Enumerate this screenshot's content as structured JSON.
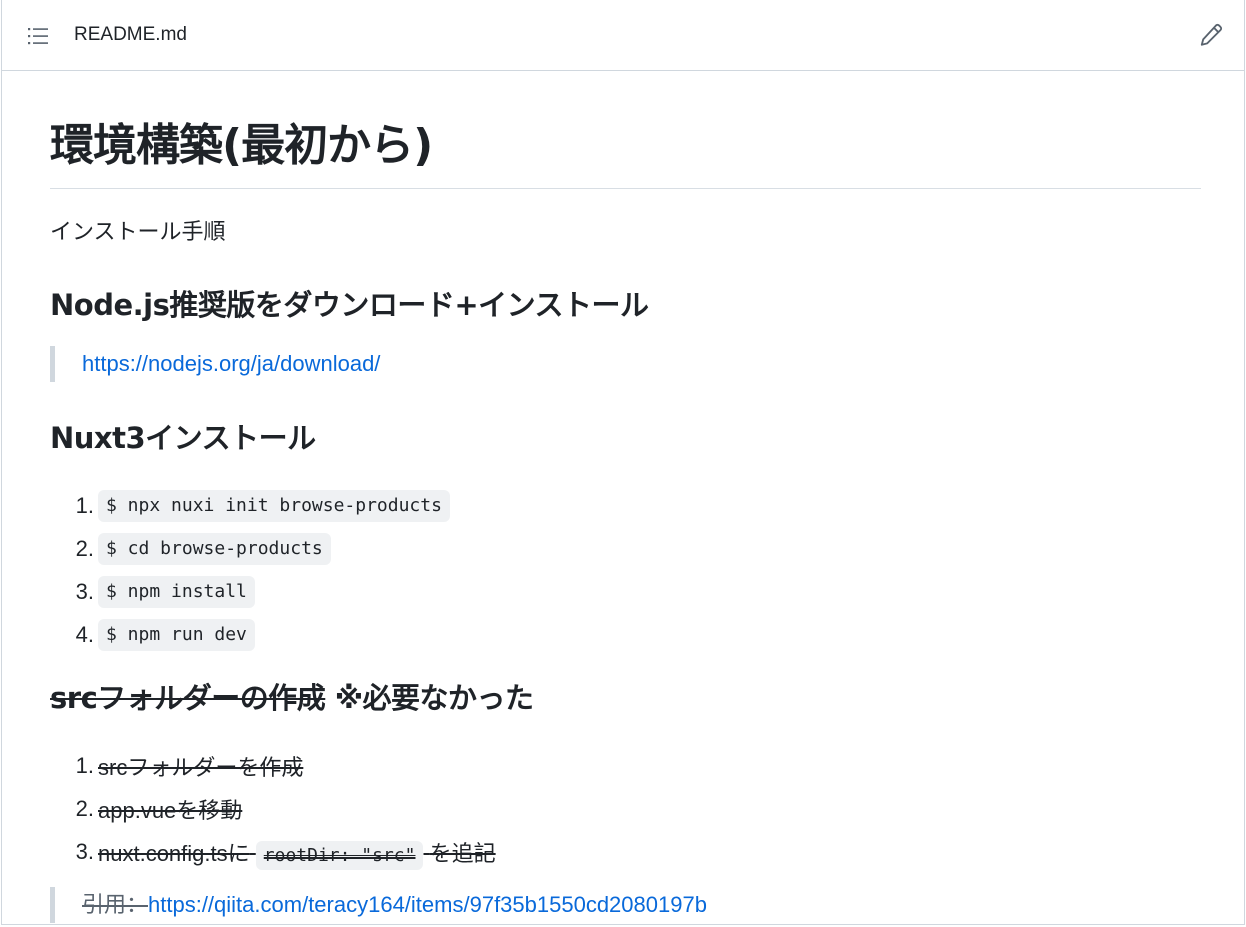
{
  "header": {
    "file_name": "README.md",
    "outline_icon": "list-unordered-icon",
    "edit_icon": "pencil-icon"
  },
  "content": {
    "h1": "環境構築(最初から)",
    "intro": "インストール手順",
    "node_section": {
      "heading": "Node.js推奨版をダウンロード+インストール",
      "link": "https://nodejs.org/ja/download/"
    },
    "nuxt_section": {
      "heading": "Nuxt3インストール",
      "steps": [
        {
          "num": "1.",
          "code": "$ npx nuxi init browse-products"
        },
        {
          "num": "2.",
          "code": "$ cd browse-products"
        },
        {
          "num": "3.",
          "code": "$ npm install"
        },
        {
          "num": "4.",
          "code": "$ npm run dev"
        }
      ]
    },
    "src_section": {
      "heading_struck": "srcフォルダーの作成",
      "heading_note": " ※必要なかった",
      "steps": [
        {
          "num": "1.",
          "text": "srcフォルダーを作成"
        },
        {
          "num": "2.",
          "text": "app.vueを移動"
        },
        {
          "num": "3.",
          "text_before": "nuxt.config.tsに",
          "code": "rootDir: \"src\"",
          "text_after": "を追記"
        }
      ],
      "citation_label": "引用：",
      "citation_link": "https://qiita.com/teracy164/items/97f35b1550cd2080197b"
    }
  },
  "colors": {
    "link": "#0969da",
    "text": "#1f2328",
    "border": "#d0d7de",
    "code_bg": "#eff1f3"
  }
}
